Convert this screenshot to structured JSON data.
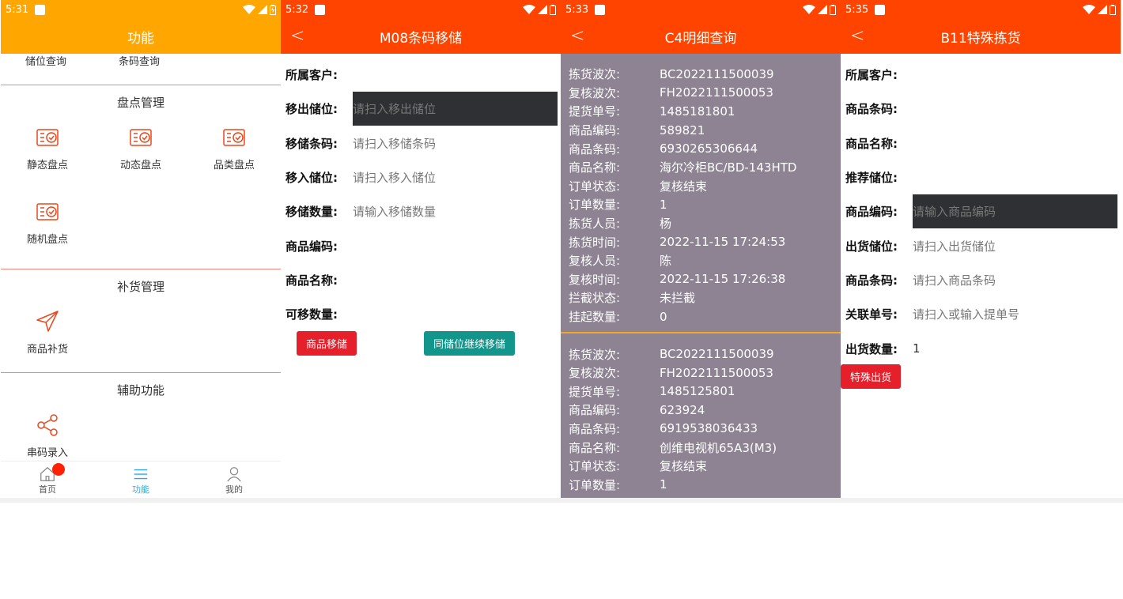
{
  "screens": [
    {
      "status_time": "5:31",
      "title": "功能",
      "top_links": [
        "储位查询",
        "条码查询"
      ],
      "sections": [
        {
          "title": "盘点管理",
          "items": [
            "静态盘点",
            "动态盘点",
            "品类盘点",
            "随机盘点"
          ]
        },
        {
          "title": "补货管理",
          "items": [
            "商品补货"
          ]
        },
        {
          "title": "辅助功能",
          "items": [
            "串码录入"
          ]
        }
      ],
      "tabs": [
        "首页",
        "功能",
        "我的"
      ]
    },
    {
      "status_time": "5:32",
      "title": "M08条码移储",
      "fields": [
        {
          "label": "所属客户:",
          "placeholder": ""
        },
        {
          "label": "移出储位:",
          "placeholder": "请扫入移出储位"
        },
        {
          "label": "移储条码:",
          "placeholder": "请扫入移储条码"
        },
        {
          "label": "移入储位:",
          "placeholder": "请扫入移入储位"
        },
        {
          "label": "移储数量:",
          "placeholder": "请输入移储数量"
        },
        {
          "label": "商品编码:",
          "placeholder": ""
        },
        {
          "label": "商品名称:",
          "placeholder": ""
        },
        {
          "label": "可移数量:",
          "placeholder": ""
        }
      ],
      "buttons": [
        "商品移储",
        "同储位继续移储"
      ]
    },
    {
      "status_time": "5:33",
      "title": "C4明细查询",
      "records": [
        [
          {
            "k": "拣货波次:",
            "v": "BC2022111500039"
          },
          {
            "k": "复核波次:",
            "v": "FH2022111500053"
          },
          {
            "k": "提货单号:",
            "v": "1485181801"
          },
          {
            "k": "商品编码:",
            "v": "589821"
          },
          {
            "k": "商品条码:",
            "v": "6930265306644"
          },
          {
            "k": "商品名称:",
            "v": "海尔冷柜BC/BD-143HTD"
          },
          {
            "k": "订单状态:",
            "v": "复核结束"
          },
          {
            "k": "订单数量:",
            "v": "1"
          },
          {
            "k": "拣货人员:",
            "v": "杨"
          },
          {
            "k": "拣货时间:",
            "v": "2022-11-15 17:24:53"
          },
          {
            "k": "复核人员:",
            "v": "陈"
          },
          {
            "k": "复核时间:",
            "v": "2022-11-15 17:26:38"
          },
          {
            "k": "拦截状态:",
            "v": "未拦截"
          },
          {
            "k": "挂起数量:",
            "v": "0"
          }
        ],
        [
          {
            "k": "拣货波次:",
            "v": "BC2022111500039"
          },
          {
            "k": "复核波次:",
            "v": "FH2022111500053"
          },
          {
            "k": "提货单号:",
            "v": "1485125801"
          },
          {
            "k": "商品编码:",
            "v": "623924"
          },
          {
            "k": "商品条码:",
            "v": "6919538036433"
          },
          {
            "k": "商品名称:",
            "v": "创维电视机65A3(M3)"
          },
          {
            "k": "订单状态:",
            "v": "复核结束"
          },
          {
            "k": "订单数量:",
            "v": "1"
          }
        ]
      ]
    },
    {
      "status_time": "5:35",
      "title": "B11特殊拣货",
      "fields": [
        {
          "label": "所属客户:",
          "placeholder": "",
          "value": ""
        },
        {
          "label": "商品条码:",
          "placeholder": "",
          "value": ""
        },
        {
          "label": "商品名称:",
          "placeholder": "",
          "value": ""
        },
        {
          "label": "推荐储位:",
          "placeholder": "",
          "value": ""
        },
        {
          "label": "商品编码:",
          "placeholder": "请输入商品编码",
          "value": ""
        },
        {
          "label": "出货储位:",
          "placeholder": "请扫入出货储位",
          "value": ""
        },
        {
          "label": "商品条码:",
          "placeholder": "请扫入商品条码",
          "value": ""
        },
        {
          "label": "关联单号:",
          "placeholder": "请扫入或输入提单号",
          "value": ""
        },
        {
          "label": "出货数量:",
          "placeholder": "",
          "value": "1"
        }
      ],
      "buttons": [
        "特殊出货"
      ]
    }
  ],
  "colors": {
    "orange": "#ffa600",
    "red_header": "#ff4400",
    "list_bg": "#8e8393",
    "accent": "#2ea7e0"
  }
}
